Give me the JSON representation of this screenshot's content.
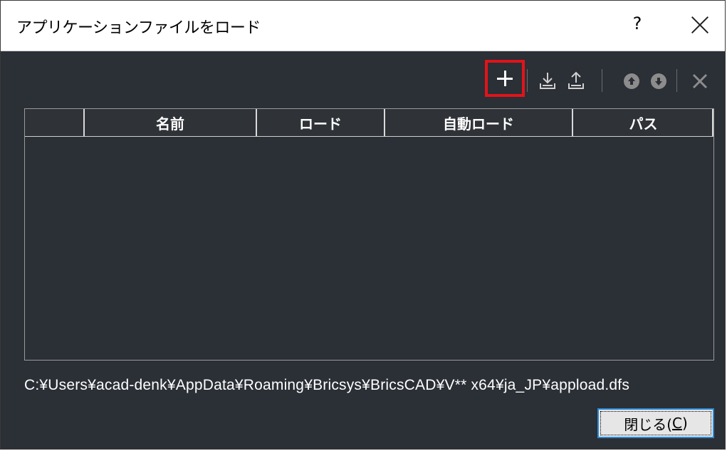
{
  "window": {
    "title": "アプリケーションファイルをロード",
    "help_label": "?",
    "close_icon": "close-icon"
  },
  "toolbar": {
    "buttons": [
      {
        "name": "add",
        "icon": "plus-icon",
        "highlighted": true,
        "highlight_color": "#e1141a"
      },
      {
        "name": "load",
        "icon": "load-icon"
      },
      {
        "name": "unload",
        "icon": "unload-icon"
      },
      {
        "name": "move-up",
        "icon": "arrow-up-circle-icon"
      },
      {
        "name": "move-down",
        "icon": "arrow-down-circle-icon"
      },
      {
        "name": "remove",
        "icon": "close-icon"
      }
    ]
  },
  "table": {
    "columns": [
      "",
      "名前",
      "ロード",
      "自動ロード",
      "パス"
    ],
    "rows": []
  },
  "footer": {
    "path": "C:¥Users¥acad-denk¥AppData¥Roaming¥Bricsys¥BricsCAD¥V** x64¥ja_JP¥appload.dfs",
    "close_button_main": "閉じる(",
    "close_button_accel": "C",
    "close_button_end": ")"
  },
  "colors": {
    "background": "#2b2f36",
    "text": "#ffffff",
    "focus_border": "#2a8ad4"
  }
}
